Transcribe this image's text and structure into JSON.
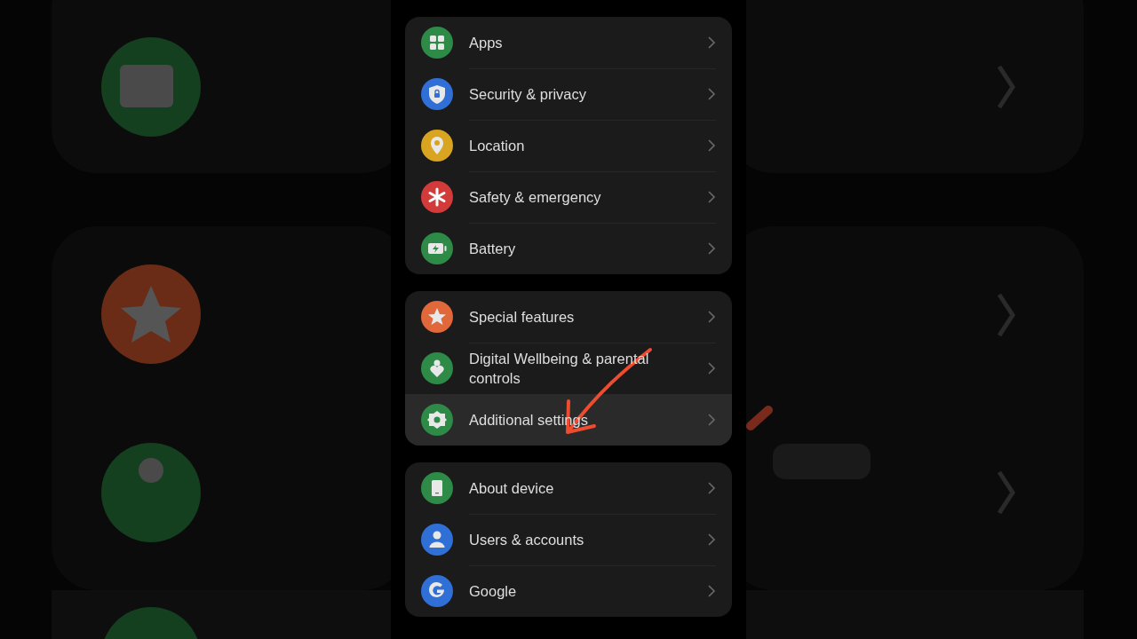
{
  "groups": [
    {
      "items": [
        {
          "label": "Apps",
          "color": "#2e8b47",
          "selected": false
        },
        {
          "label": "Security & privacy",
          "color": "#2f6fd6",
          "selected": false
        },
        {
          "label": "Location",
          "color": "#d9a520",
          "selected": false
        },
        {
          "label": "Safety & emergency",
          "color": "#d33a3a",
          "selected": false
        },
        {
          "label": "Battery",
          "color": "#2e8b47",
          "selected": false
        }
      ]
    },
    {
      "items": [
        {
          "label": "Special features",
          "color": "#e0683a",
          "selected": false
        },
        {
          "label": "Digital Wellbeing & parental controls",
          "color": "#2e8b47",
          "selected": false
        },
        {
          "label": "Additional settings",
          "color": "#2e8b47",
          "selected": true
        }
      ]
    },
    {
      "items": [
        {
          "label": "About device",
          "color": "#2e8b47",
          "selected": false
        },
        {
          "label": "Users & accounts",
          "color": "#2f6fd6",
          "selected": false
        },
        {
          "label": "Google",
          "color": "#2f6fd6",
          "selected": false
        }
      ]
    }
  ]
}
